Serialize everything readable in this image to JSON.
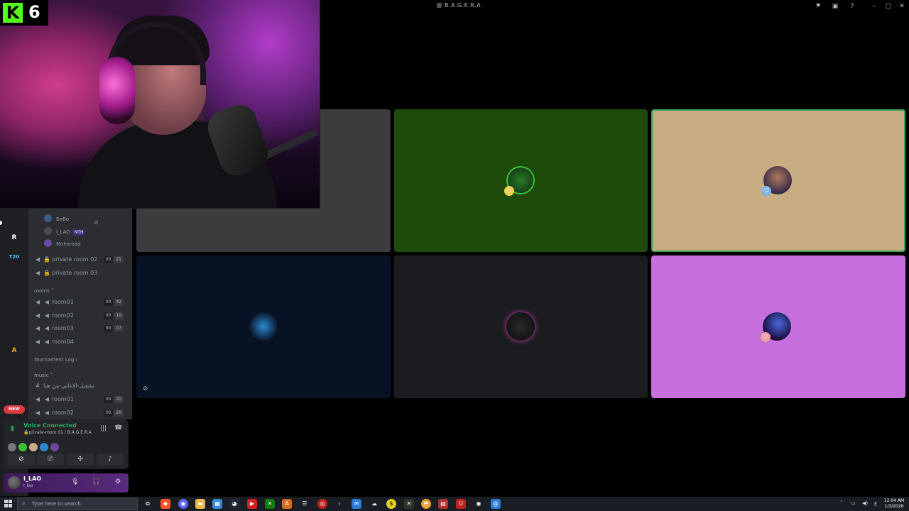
{
  "window": {
    "title": "B.A.G.E.R.A"
  },
  "webcam": {
    "badge_letter": "K",
    "badge_number": "6",
    "badge_color": "#53fc18"
  },
  "server_rail": {
    "items": [
      {
        "name": "crossed-swords-server",
        "label": "",
        "bg": "#d8d8d8"
      },
      {
        "name": "r-server",
        "label": "R",
        "bg": "#5b2ec4"
      },
      {
        "name": "t20-server",
        "label": "T20",
        "bg": "#1e1f22"
      },
      {
        "name": "hex-server",
        "label": "",
        "bg": "#1f6b3a"
      },
      {
        "name": "blue-x-server",
        "label": "",
        "bg": "#1e3a6b"
      },
      {
        "name": "ring-server",
        "label": "",
        "bg": "#0d1a3a"
      },
      {
        "name": "dark-server",
        "label": "",
        "bg": "#2a1a3a"
      },
      {
        "name": "triangle-server",
        "label": "A",
        "bg": "#2b2018"
      },
      {
        "name": "green-server",
        "label": "",
        "bg": "#7bd81c"
      },
      {
        "name": "lungs-server",
        "label": "",
        "bg": "#2a2a2a"
      }
    ],
    "new_badge": "NEW"
  },
  "channels": {
    "members": [
      {
        "name": "BeBo",
        "tag": ""
      },
      {
        "name": "I_LAO",
        "tag": "NTH"
      },
      {
        "name": "Mohamad",
        "tag": ""
      }
    ],
    "private_rooms": [
      {
        "name": "private room 02",
        "count_a": "00",
        "count_b": "21"
      },
      {
        "name": "private room 03",
        "count_a": "",
        "count_b": ""
      }
    ],
    "rooms_category": "rooms",
    "rooms": [
      {
        "name": "room01",
        "count_a": "00",
        "count_b": "42"
      },
      {
        "name": "room02",
        "count_a": "00",
        "count_b": "10"
      },
      {
        "name": "room03",
        "count_a": "00",
        "count_b": "07"
      },
      {
        "name": "room04",
        "count_a": "",
        "count_b": ""
      }
    ],
    "tournament_category": "Tournament Log",
    "music_category": "music",
    "music_text_channel": "تشغيل-الاغاني-من-هنا",
    "music_rooms": [
      {
        "name": "room01",
        "count_a": "00",
        "count_b": "20"
      },
      {
        "name": "room02",
        "count_a": "00",
        "count_b": "20"
      }
    ]
  },
  "voice_panel": {
    "status": "Voice Connected",
    "room": "private-room 01 / B.A.G.E.R.A",
    "status_color": "#23a55a"
  },
  "user_panel": {
    "username": "I_LAO",
    "status": "I_lao"
  },
  "video_tiles": [
    {
      "name": "tile-gray",
      "color": "#3c3c3e"
    },
    {
      "name": "tile-green",
      "color": "#1e4a0b"
    },
    {
      "name": "tile-tan",
      "color": "#c8ac82"
    },
    {
      "name": "tile-navy",
      "color": "#071324"
    },
    {
      "name": "tile-dark",
      "color": "#1a1c1f"
    },
    {
      "name": "tile-pink",
      "color": "#c76fdc"
    }
  ],
  "taskbar": {
    "search_placeholder": "Type here to search",
    "clock_time": "12:04 AM",
    "clock_date": "1/3/2026"
  }
}
